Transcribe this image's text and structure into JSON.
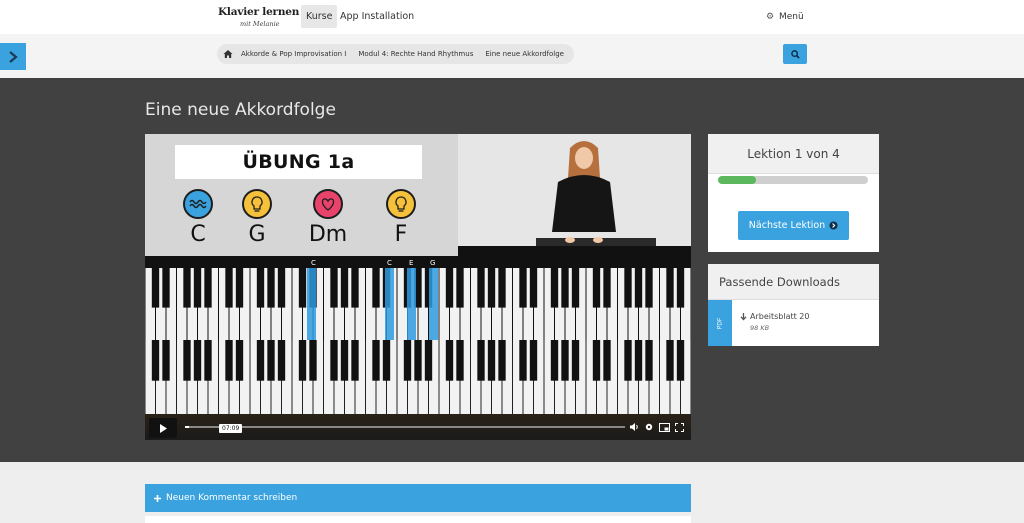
{
  "brand": {
    "logo_text": "Klavier lernen",
    "logo_sub": "mit Melanie"
  },
  "nav": {
    "courses": "Kurse",
    "app_install": "App Installation",
    "menu": "Menü"
  },
  "breadcrumb": {
    "items": [
      "Akkorde & Pop Improvisation I",
      "Modul 4: Rechte Hand Rhythmus",
      "Eine neue Akkordfolge"
    ]
  },
  "page": {
    "title": "Eine neue Akkordfolge"
  },
  "video": {
    "exercise": "ÜBUNG 1a",
    "chords": [
      "C",
      "G",
      "Dm",
      "F"
    ],
    "chord_colors": [
      "#3aa3df",
      "#f5c13a",
      "#e8436b",
      "#f5c13a"
    ],
    "chord_icons": [
      "wave-icon",
      "bulb-icon",
      "heart-icon",
      "bulb-icon"
    ],
    "note_labels": [
      "C",
      "C",
      "E",
      "G"
    ],
    "timestamp": "07:09",
    "progress": 0.01
  },
  "lesson": {
    "title": "Lektion 1 von 4",
    "progress": 0.25,
    "next_label": "Nächste Lektion"
  },
  "downloads": {
    "title": "Passende Downloads",
    "file_type": "PDF",
    "file_name": "Arbeitsblatt 20",
    "file_size": "98 KB"
  },
  "comments": {
    "new_comment_label": "Neuen Kommentar schreiben"
  },
  "colors": {
    "accent": "#3aa3df",
    "dark_bg": "#414141",
    "progress_green": "#5cb85c"
  }
}
